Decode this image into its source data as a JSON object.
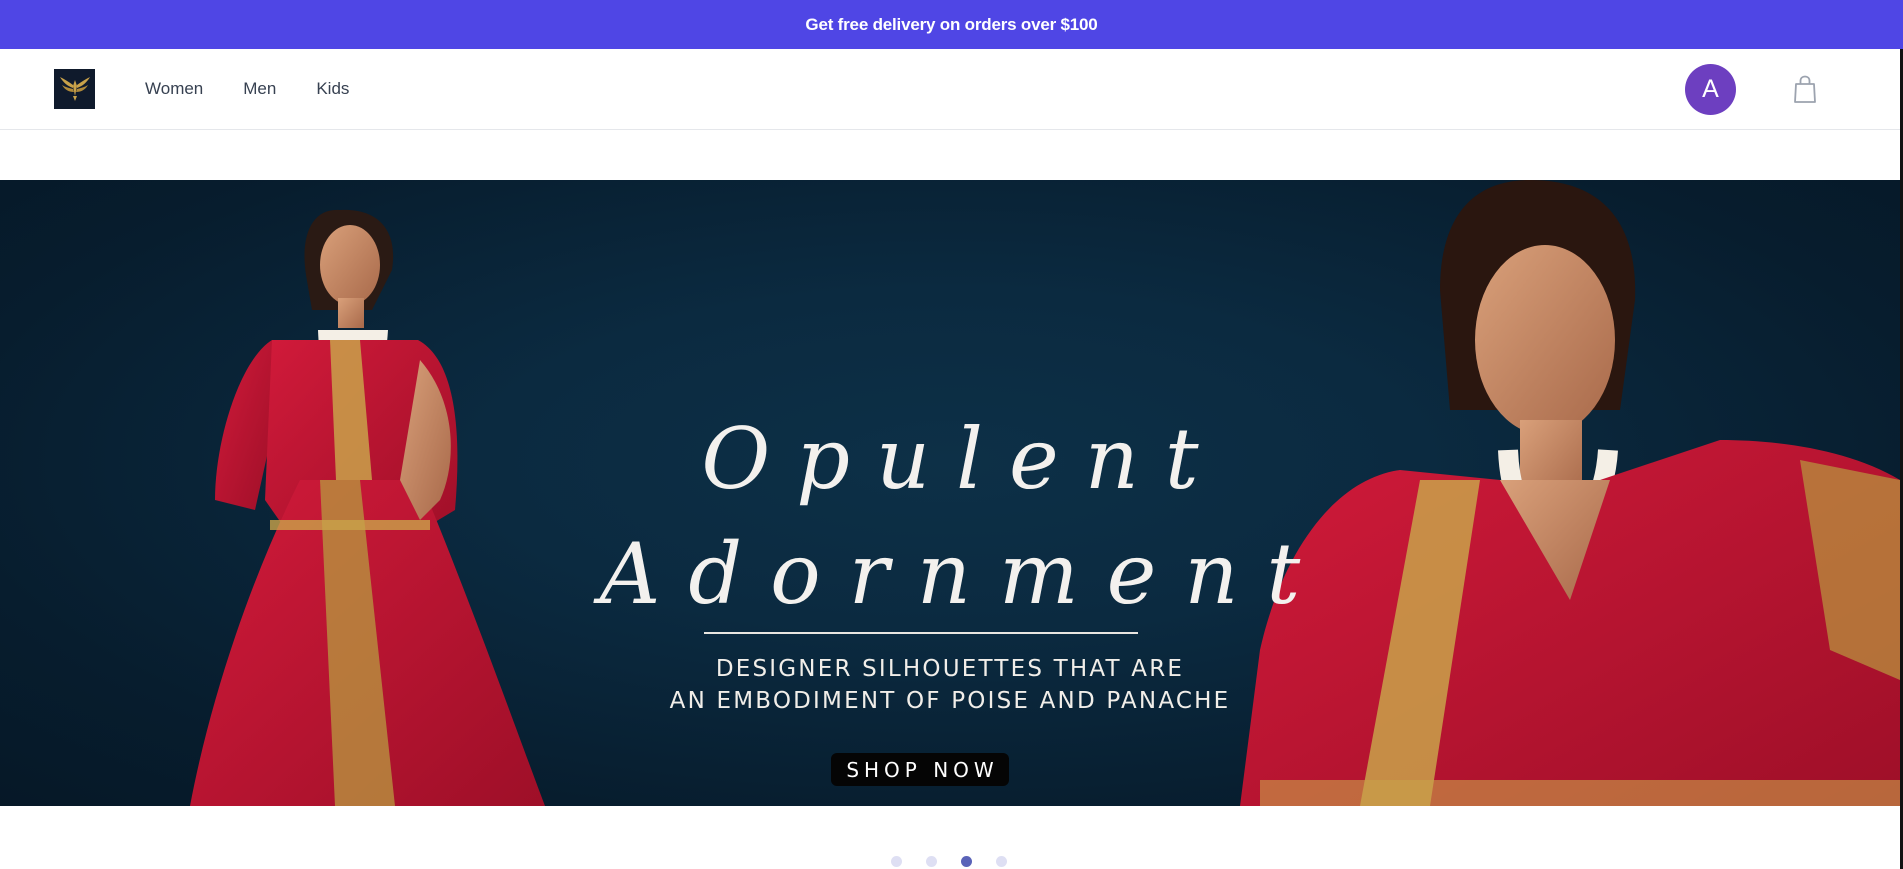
{
  "promo": {
    "text": "Get free delivery on orders over $100"
  },
  "header": {
    "logo_icon": "eagle-logo-icon",
    "nav": [
      {
        "label": "Women"
      },
      {
        "label": "Men"
      },
      {
        "label": "Kids"
      }
    ],
    "avatar_initial": "A",
    "cart_icon": "shopping-bag-icon"
  },
  "hero": {
    "title_line1": "Opulent",
    "title_line2": "Adornment",
    "subtitle_line1": "DESIGNER SILHOUETTES THAT ARE",
    "subtitle_line2": "AN EMBODIMENT OF POISE AND PANACHE",
    "cta_label": "SHOP NOW"
  },
  "carousel": {
    "slide_count": 4,
    "active_slide": 3
  },
  "colors": {
    "accent": "#4f46e5",
    "avatar": "#6d3fc0",
    "hero_bg": "#0b2a40",
    "garment_red": "#c8102e",
    "gold": "#c9a24a"
  }
}
